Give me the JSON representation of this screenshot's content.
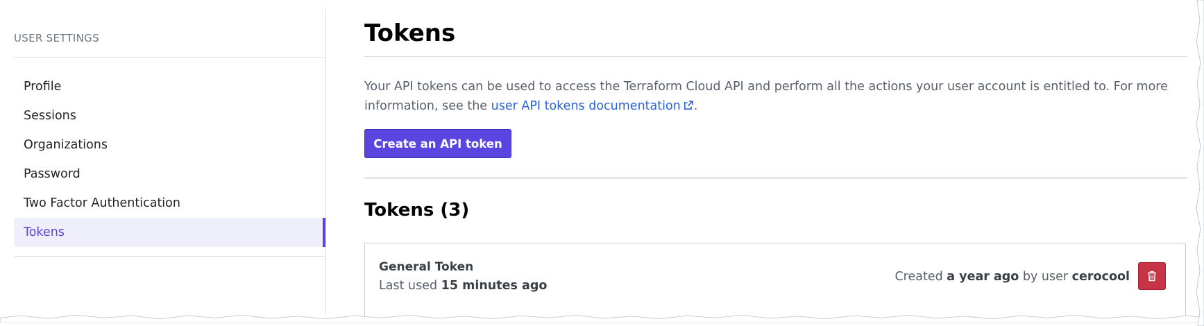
{
  "sidebar": {
    "heading": "USER SETTINGS",
    "items": [
      {
        "label": "Profile",
        "active": false
      },
      {
        "label": "Sessions",
        "active": false
      },
      {
        "label": "Organizations",
        "active": false
      },
      {
        "label": "Password",
        "active": false
      },
      {
        "label": "Two Factor Authentication",
        "active": false
      },
      {
        "label": "Tokens",
        "active": true
      }
    ]
  },
  "main": {
    "title": "Tokens",
    "description_prefix": "Your API tokens can be used to access the Terraform Cloud API and perform all the actions your user account is entitled to. For more information, see the ",
    "doc_link_label": "user API tokens documentation",
    "description_suffix": ".",
    "create_button_label": "Create an API token",
    "tokens_section_title": "Tokens (3)"
  },
  "token": {
    "name": "General Token",
    "last_used_prefix": "Last used ",
    "last_used_value": "15 minutes ago",
    "created_prefix": "Created ",
    "created_value": "a year ago",
    "created_middle": " by user ",
    "created_by": "cerocool",
    "delete_icon": "trash-icon"
  },
  "colors": {
    "accent": "#5b45e0",
    "active_nav_bg": "#efeefb",
    "link": "#2a63d8",
    "danger": "#c73445"
  }
}
